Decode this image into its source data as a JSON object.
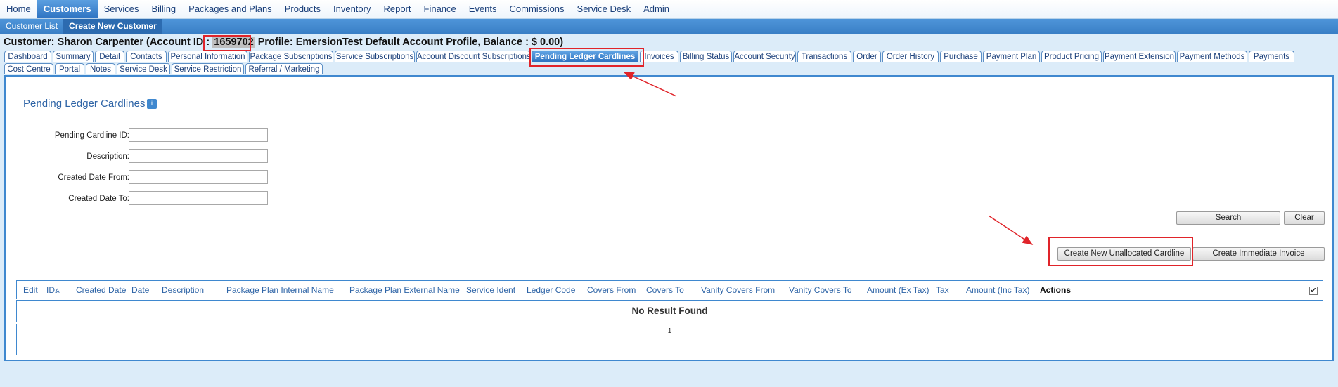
{
  "topnav": [
    "Home",
    "Customers",
    "Services",
    "Billing",
    "Packages and Plans",
    "Products",
    "Inventory",
    "Report",
    "Finance",
    "Events",
    "Commissions",
    "Service Desk",
    "Admin"
  ],
  "subnav": [
    "Customer List",
    "Create New Customer"
  ],
  "customer": {
    "prefix": "Customer: Sharon Carpenter (Account ID : ",
    "account_id": "1659702",
    "suffix": " Profile: EmersionTest Default Account Profile, Balance : $ 0.00)"
  },
  "tabs_row1": [
    "Dashboard",
    "Summary",
    "Detail",
    "Contacts",
    "Personal Information",
    "Package Subscriptions",
    "Service Subscriptions",
    "Account Discount Subscriptions",
    "Pending Ledger Cardlines",
    "Invoices",
    "Billing Status",
    "Account Security",
    "Transactions",
    "Order",
    "Order History",
    "Purchase",
    "Payment Plan",
    "Product Pricing",
    "Payment Extension",
    "Payment Methods",
    "Payments"
  ],
  "tabs_row2": [
    "Cost Centre",
    "Portal",
    "Notes",
    "Service Desk",
    "Service Restriction",
    "Referral / Marketing"
  ],
  "panel": {
    "title": "Pending Ledger Cardlines",
    "info_icon": "i",
    "fields": [
      {
        "label": "Pending Cardline ID:",
        "value": ""
      },
      {
        "label": "Description:",
        "value": ""
      },
      {
        "label": "Created Date From:",
        "value": ""
      },
      {
        "label": "Created Date To:",
        "value": ""
      }
    ],
    "buttons": {
      "search": "Search",
      "clear": "Clear",
      "create_unallocated": "Create New Unallocated Cardline",
      "create_invoice": "Create Immediate Invoice"
    },
    "columns": [
      "Edit",
      "ID",
      "Created Date",
      "Date",
      "Description",
      "Package Plan Internal Name",
      "Package Plan External Name",
      "Service Ident",
      "Ledger Code",
      "Covers From",
      "Covers To",
      "Vanity Covers From",
      "Vanity Covers To",
      "Amount (Ex Tax)",
      "Tax",
      "Amount (Inc Tax)",
      "Actions"
    ],
    "sort_icon": "⩓",
    "check_mark": "✔",
    "empty_text": "No Result Found",
    "page_number": "1"
  },
  "colors": {
    "accent": "#3f88cf",
    "highlight": "#e0242a"
  }
}
